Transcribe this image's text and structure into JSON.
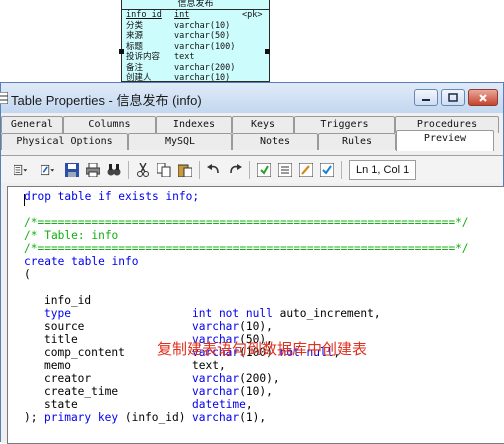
{
  "diagram": {
    "entity_title": "信息发布",
    "rows": [
      {
        "name": "info_id",
        "type": "int",
        "key": "<pk>"
      },
      {
        "name": "分类",
        "type": "varchar(10)",
        "key": ""
      },
      {
        "name": "来源",
        "type": "varchar(50)",
        "key": ""
      },
      {
        "name": "标题",
        "type": "varchar(100)",
        "key": ""
      },
      {
        "name": "投诉内容",
        "type": "text",
        "key": ""
      },
      {
        "name": "备注",
        "type": "varchar(200)",
        "key": ""
      },
      {
        "name": "创建人",
        "type": "varchar(10)",
        "key": ""
      }
    ]
  },
  "window": {
    "title": "Table Properties - 信息发布 (info)",
    "icons": {
      "minimize": "minimize-icon",
      "maximize": "maximize-icon",
      "close": "close-icon"
    }
  },
  "tabs": {
    "row1": [
      "General",
      "Columns",
      "Indexes",
      "Keys",
      "Triggers",
      "Procedures"
    ],
    "row2": [
      "Physical Options",
      "MySQL",
      "Notes",
      "Rules",
      "Preview"
    ],
    "active": "Preview"
  },
  "toolbar": {
    "icons": [
      "properties-icon",
      "edit-icon",
      "save-icon",
      "print-icon",
      "find-icon",
      "cut-icon",
      "copy-icon",
      "paste-icon",
      "undo-icon",
      "redo-icon",
      "run-icon",
      "page-icon",
      "edit-page-icon",
      "check-icon"
    ],
    "status": "Ln 1, Col 1"
  },
  "code": {
    "drop": "drop table if exists info;",
    "comment_rule": "/*==============================================================*/",
    "comment_table": "/* Table: info",
    "create": "create table info",
    "open_paren": "(",
    "columns": [
      {
        "name": "info_id",
        "type": "int not null",
        "rest": "auto_increment,"
      },
      {
        "name": "type",
        "type": "varchar",
        "rest": "(10),"
      },
      {
        "name": "source",
        "type": "varchar",
        "rest": "(50),"
      },
      {
        "name": "title",
        "type": "varchar",
        "rest": "(100)",
        "after": "not null",
        "tail": ","
      },
      {
        "name": "comp_content",
        "type": "",
        "rest": "text,"
      },
      {
        "name": "memo",
        "type": "varchar",
        "rest": "(200),"
      },
      {
        "name": "creator",
        "type": "varchar",
        "rest": "(10),"
      },
      {
        "name": "create_time",
        "type": "datetime",
        "rest": ","
      },
      {
        "name": "state",
        "type": "varchar",
        "rest": "(1),"
      }
    ],
    "primary_key_kw": "primary key",
    "primary_key_col": "(info_id)",
    "close": ");"
  },
  "annotation": "复制建表语句到数据库中创建表",
  "colors": {
    "keyword": "#0000ee",
    "comment": "#10b010",
    "annotation": "#e0301e",
    "entity_fill": "#cdfcfd"
  }
}
